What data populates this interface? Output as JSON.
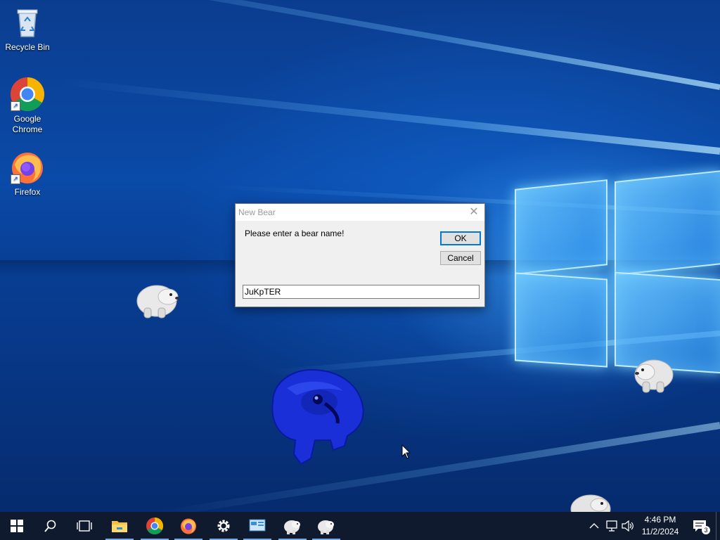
{
  "desktop": {
    "icons": [
      {
        "label": "Recycle Bin",
        "icon": "recycle-bin-icon"
      },
      {
        "label": "Google\nChrome",
        "icon": "chrome-icon"
      },
      {
        "label": "Firefox",
        "icon": "firefox-icon"
      }
    ]
  },
  "dialog": {
    "title": "New Bear",
    "message": "Please enter a bear name!",
    "ok_label": "OK",
    "cancel_label": "Cancel",
    "input_value": "JuKpTER"
  },
  "taskbar": {
    "apps": [
      "start-icon",
      "search-icon",
      "task-view-icon",
      "file-explorer-icon",
      "chrome-icon",
      "firefox-icon",
      "settings-icon",
      "control-panel-icon",
      "bear-icon",
      "bear-icon"
    ],
    "clock_time": "4:46 PM",
    "clock_date": "11/2/2024",
    "notification_count": "3"
  }
}
